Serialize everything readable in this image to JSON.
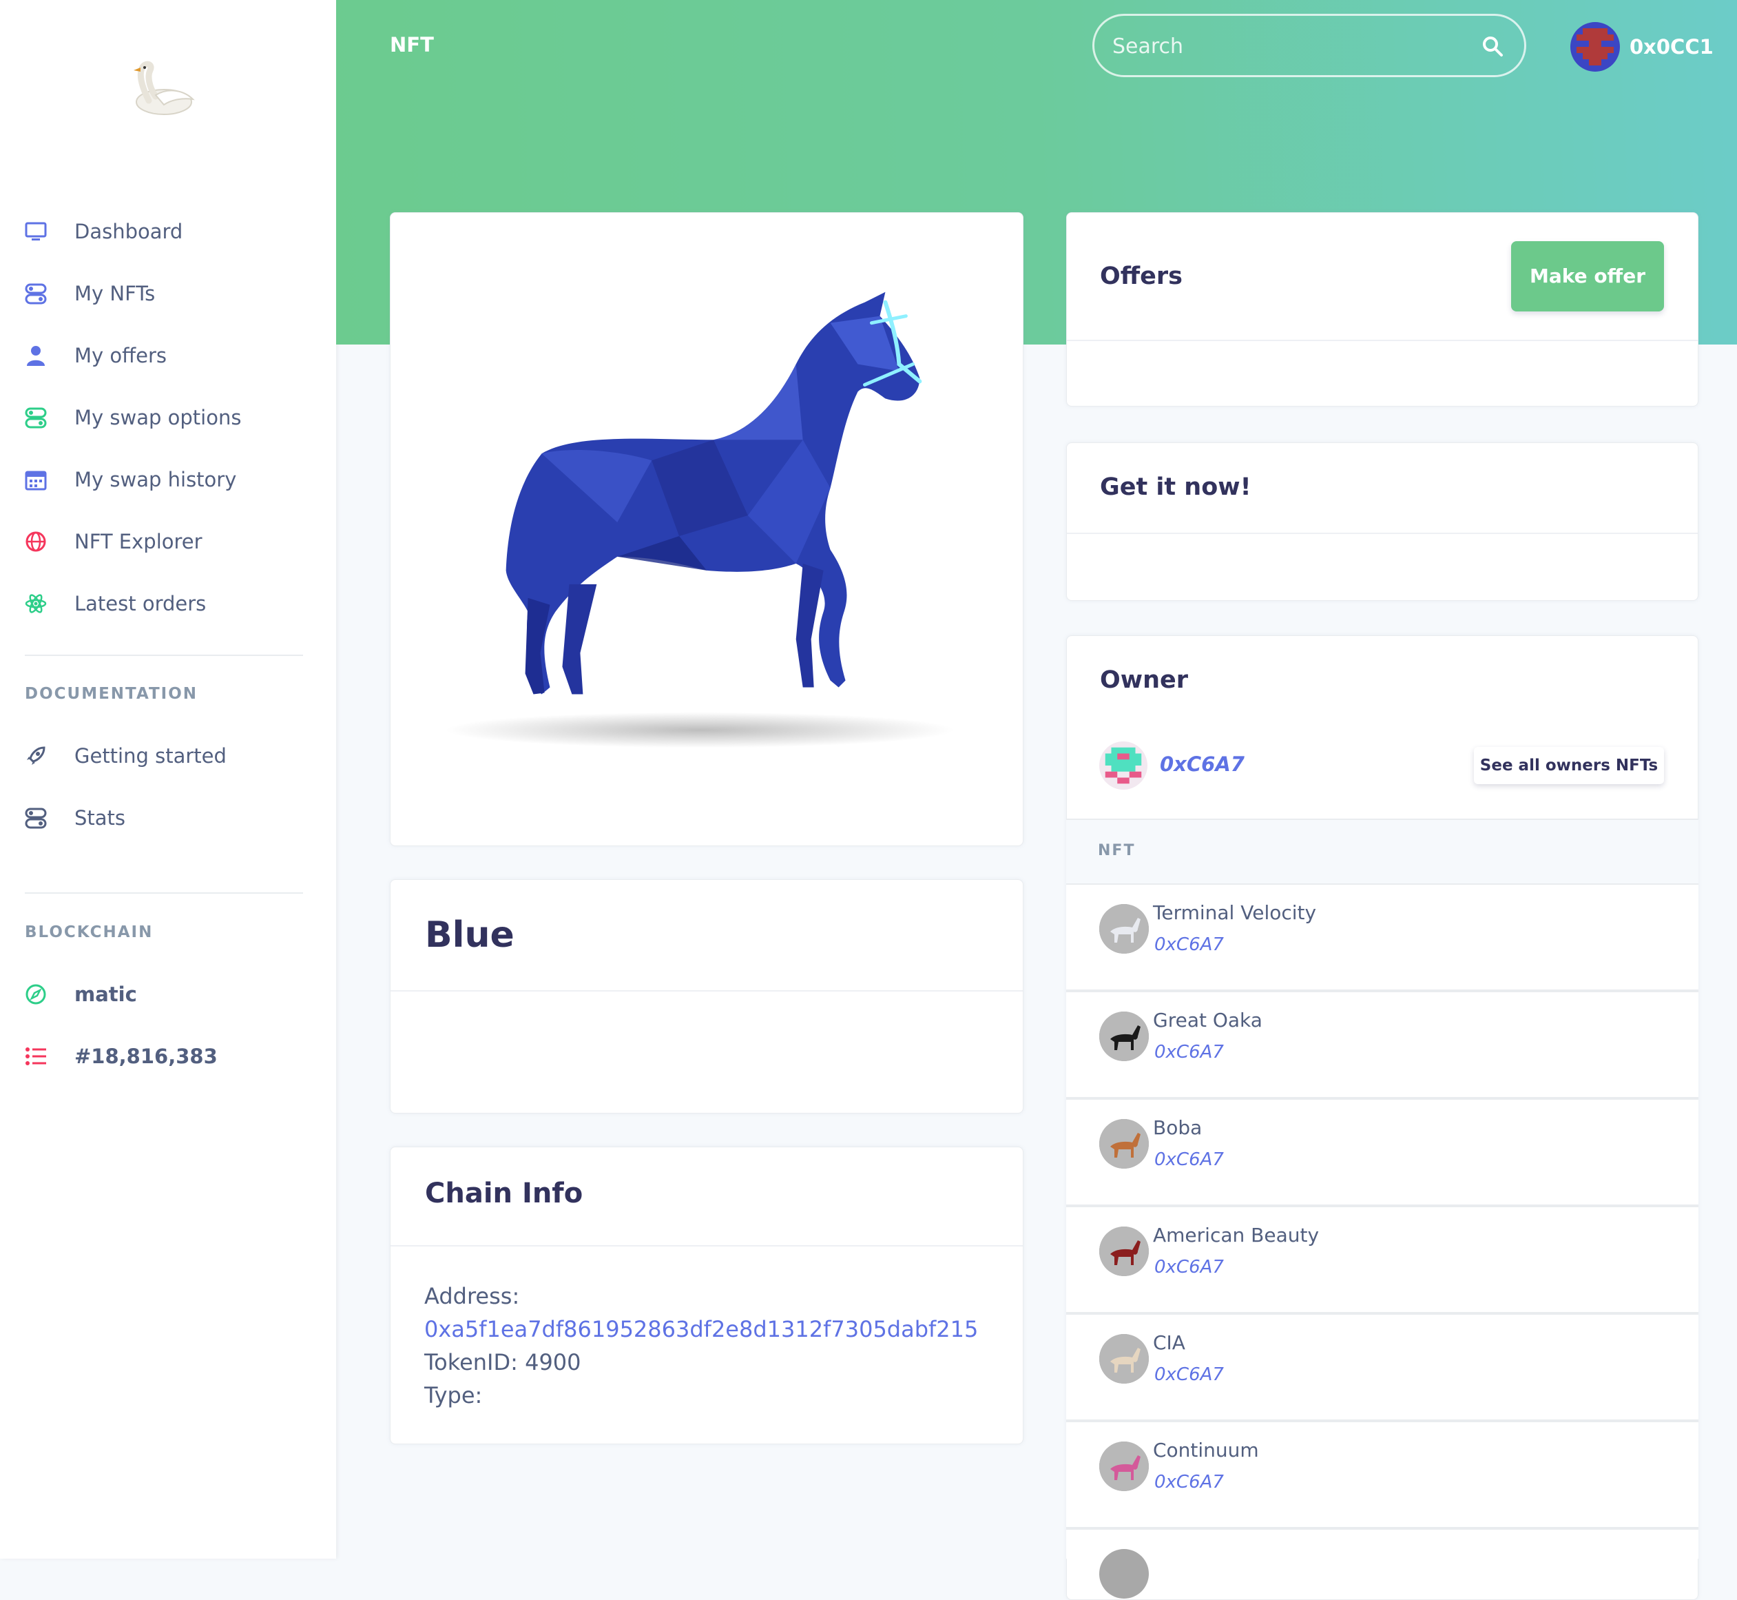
{
  "header": {
    "title": "NFT",
    "search_placeholder": "Search",
    "user_name": "0x0CC1"
  },
  "sidebar": {
    "items": [
      {
        "label": "Dashboard",
        "icon": "monitor-icon"
      },
      {
        "label": "My NFTs",
        "icon": "toggles-icon"
      },
      {
        "label": "My offers",
        "icon": "user-icon"
      },
      {
        "label": "My swap options",
        "icon": "toggles-icon"
      },
      {
        "label": "My swap history",
        "icon": "calendar-icon"
      },
      {
        "label": "NFT Explorer",
        "icon": "globe-icon"
      },
      {
        "label": "Latest orders",
        "icon": "atom-icon"
      }
    ],
    "documentation_heading": "DOCUMENTATION",
    "doc_items": [
      {
        "label": "Getting started",
        "icon": "rocket-icon"
      },
      {
        "label": "Stats",
        "icon": "toggles-icon"
      }
    ],
    "blockchain_heading": "BLOCKCHAIN",
    "chain_items": [
      {
        "label": "matic",
        "icon": "compass-icon"
      },
      {
        "label": "#18,816,383",
        "icon": "list-icon"
      }
    ]
  },
  "colors": {
    "accent": "#5e72e4",
    "header_gradient_start": "#6ccb8f",
    "header_gradient_end": "#6cccc8",
    "button_green": "#6cc98b",
    "horse_blue": "#2a3fb0"
  },
  "nft": {
    "name": "Blue",
    "image": "blue-low-poly-horse"
  },
  "chain_info": {
    "title": "Chain Info",
    "address_label": "Address:",
    "address": "0xa5f1ea7df861952863df2e8d1312f7305dabf215",
    "token_label": "TokenID: 4900",
    "type_label": "Type:"
  },
  "offers": {
    "title": "Offers",
    "button": "Make offer"
  },
  "get_now": {
    "title": "Get it now!"
  },
  "owner": {
    "title": "Owner",
    "address": "0xC6A7",
    "see_all": "See all owners NFTs",
    "nft_header": "NFT",
    "nfts": [
      {
        "name": "Terminal Velocity",
        "owner": "0xC6A7",
        "color": "#e8eaf0"
      },
      {
        "name": "Great Oaka",
        "owner": "0xC6A7",
        "color": "#1a1a1a"
      },
      {
        "name": "Boba",
        "owner": "0xC6A7",
        "color": "#c0703a"
      },
      {
        "name": "American Beauty",
        "owner": "0xC6A7",
        "color": "#8b1e1e"
      },
      {
        "name": "CIA",
        "owner": "0xC6A7",
        "color": "#e6d6c0"
      },
      {
        "name": "Continuum",
        "owner": "0xC6A7",
        "color": "#d45a9a"
      }
    ]
  }
}
